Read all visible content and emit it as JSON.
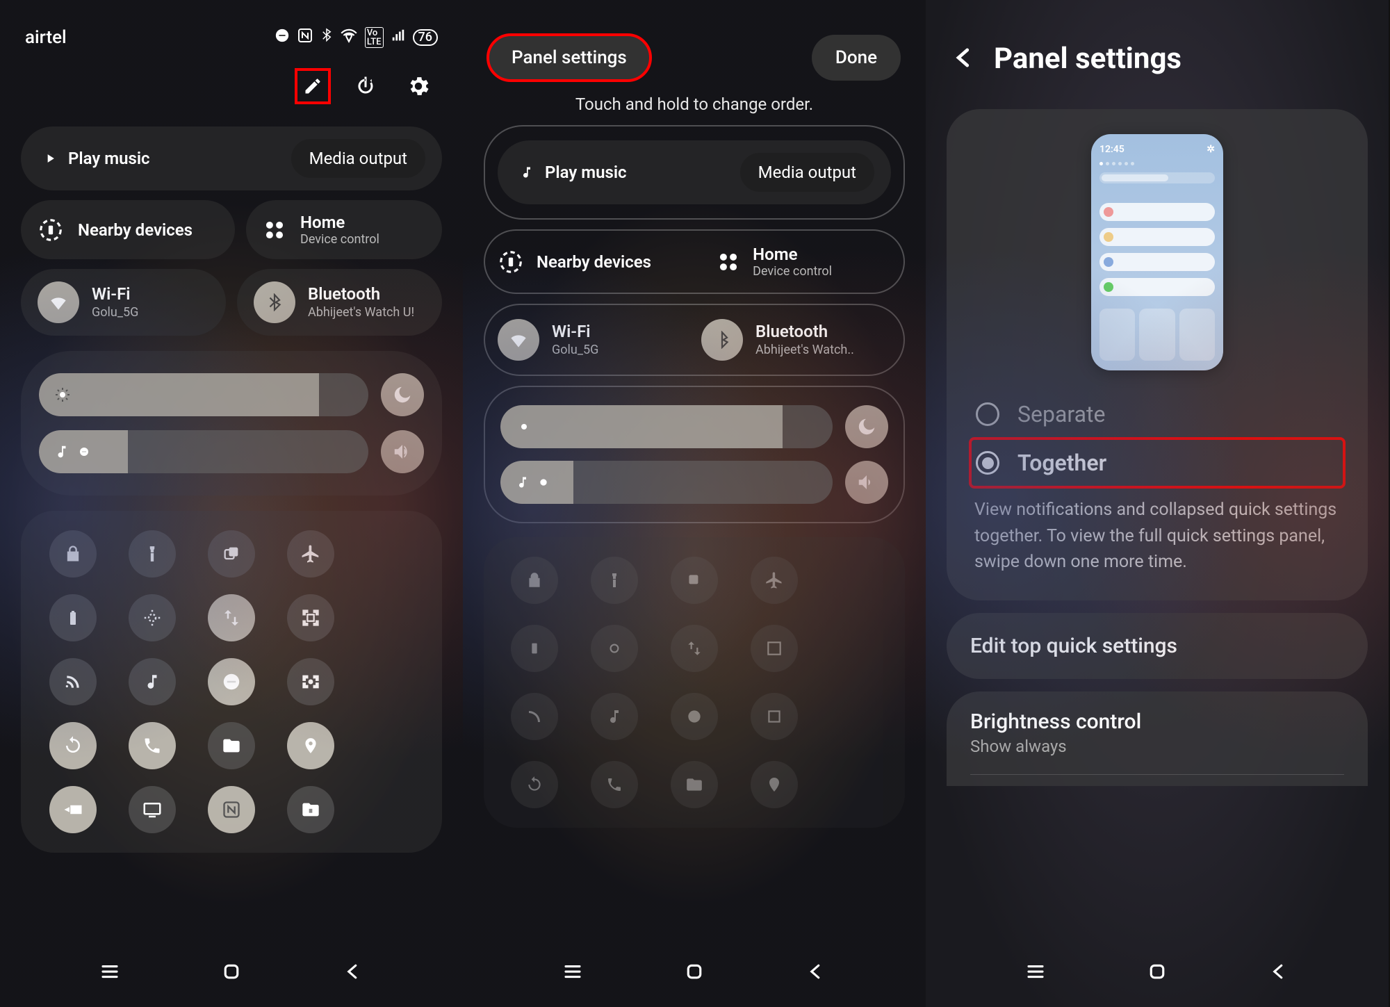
{
  "phone1": {
    "carrier": "airtel",
    "battery": "76",
    "media": {
      "play": "Play music",
      "output": "Media output"
    },
    "row1": {
      "nearby": "Nearby devices",
      "home": {
        "title": "Home",
        "sub": "Device control"
      }
    },
    "row2": {
      "wifi": {
        "title": "Wi-Fi",
        "sub": "Golu_5G"
      },
      "bt": {
        "title": "Bluetooth",
        "sub": "Abhijeet's Watch U!"
      }
    }
  },
  "phone2": {
    "panel_btn": "Panel settings",
    "done_btn": "Done",
    "subtitle": "Touch and hold to change order.",
    "media": {
      "play": "Play music",
      "output": "Media output"
    },
    "row1": {
      "nearby": "Nearby devices",
      "home": {
        "title": "Home",
        "sub": "Device control"
      }
    },
    "row2": {
      "wifi": {
        "title": "Wi-Fi",
        "sub": "Golu_5G"
      },
      "bt": {
        "title": "Bluetooth",
        "sub": "Abhijeet's Watch.."
      }
    }
  },
  "phone3": {
    "title": "Panel settings",
    "preview_time": "12:45",
    "opt_separate": "Separate",
    "opt_together": "Together",
    "desc": "View notifications and collapsed quick settings together. To view the full quick settings panel, swipe down one more time.",
    "edit_top": "Edit top quick settings",
    "brightness": {
      "title": "Brightness control",
      "sub": "Show always"
    }
  }
}
